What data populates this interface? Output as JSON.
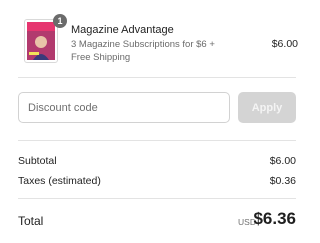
{
  "product": {
    "quantity": "1",
    "image_icon": "magazine-cover-icon",
    "title": "Magazine Advantage",
    "description": "3 Magazine Subscriptions for $6 + Free Shipping",
    "price": "$6.00"
  },
  "discount": {
    "placeholder": "Discount code",
    "apply_label": "Apply"
  },
  "summary": {
    "subtotal_label": "Subtotal",
    "subtotal_value": "$6.00",
    "taxes_label": "Taxes (estimated)",
    "taxes_value": "$0.36",
    "total_label": "Total",
    "currency": "USD",
    "total_value": "$6.36"
  },
  "colors": {
    "badge": "#6b6b6b",
    "apply_disabled": "#d4d4d4",
    "divider": "#e3e3e3"
  }
}
